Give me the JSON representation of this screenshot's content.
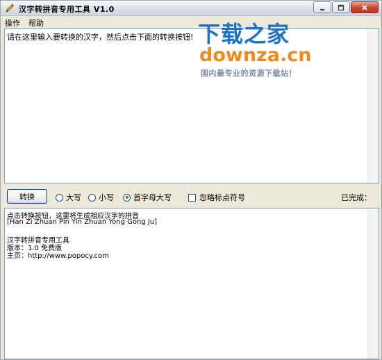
{
  "window": {
    "title": "汉字转拼音专用工具 V1.0",
    "icons": {
      "app": "pencil-icon",
      "minimize": "minimize-icon",
      "maximize": "maximize-icon",
      "close": "close-icon"
    }
  },
  "menu": [
    "操作",
    "帮助"
  ],
  "input": {
    "value": "请在这里输入要转换的汉字，然后点击下面的转换按钮!"
  },
  "watermark": {
    "line1": "下载之家",
    "line2": "downza.cn",
    "line3": "国内最专业的资源下载站！"
  },
  "controls": {
    "convert_label": "转换",
    "radio_options": [
      {
        "label": "大写",
        "selected": false
      },
      {
        "label": "小写",
        "selected": false
      },
      {
        "label": "首字母大写",
        "selected": true
      }
    ],
    "checkbox_label": "忽略标点符号",
    "checkbox_checked": false,
    "status_label": "已完成："
  },
  "output": {
    "lines": [
      "点击转换按钮，这里将生成相应汉字的拼音",
      "[Han Zi Zhuan Pin Yin Zhuan Yong Gong Ju]",
      "",
      "汉字转拼音专用工具",
      "版本：1.0 免费版",
      "主页：http://www.popocy.com"
    ]
  },
  "colors": {
    "watermark_blue": "#1c73c5",
    "watermark_orange": "#f08a1c"
  }
}
